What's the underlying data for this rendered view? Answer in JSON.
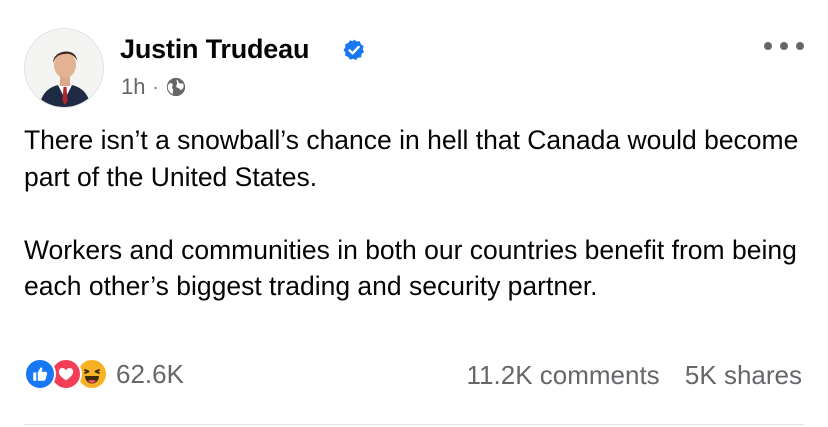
{
  "author": {
    "name": "Justin Trudeau",
    "verified": true,
    "timestamp": "1h",
    "separator": "·",
    "audience_icon": "globe-icon"
  },
  "menu_icon": "more-options-icon",
  "post": {
    "paragraphs": [
      "There isn’t a snowball’s chance in hell that Canada would become part of the United States.",
      "Workers and communities in both our countries benefit from being each other’s biggest trading and security partner."
    ]
  },
  "reactions": {
    "icons": [
      "like-icon",
      "love-icon",
      "haha-icon"
    ],
    "count": "62.6K"
  },
  "engagement": {
    "comments": "11.2K comments",
    "shares": "5K shares"
  },
  "colors": {
    "verified_blue": "#1877f2",
    "like_blue": "#1877f2",
    "love_red": "#f33e58",
    "haha_yellow": "#f7b125",
    "secondary_text": "#65676b"
  }
}
